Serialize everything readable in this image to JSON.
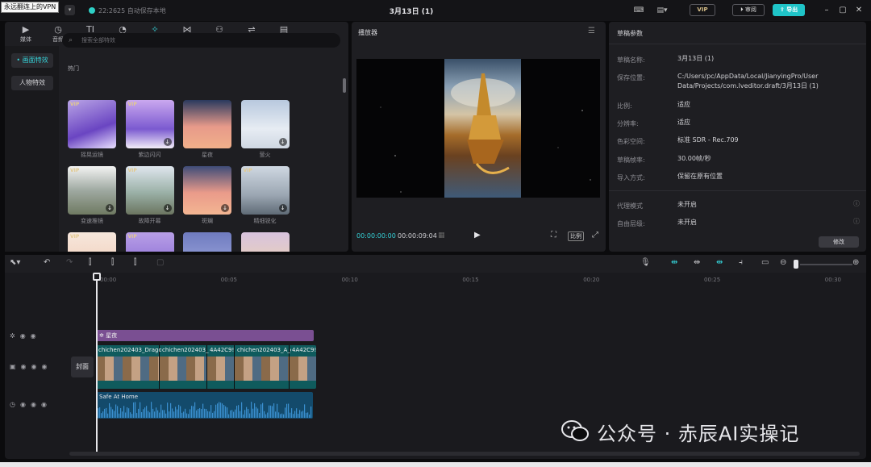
{
  "topbar": {
    "vpn_tip": "永远翻连上的VPN",
    "save_status": "22:2625 自动保存本地",
    "project_title": "3月13日 (1)",
    "vip_label": "VIP",
    "review_label": "审阅",
    "export_label": "导出"
  },
  "library": {
    "tabs": [
      {
        "icon": "▶",
        "label": "媒体"
      },
      {
        "icon": "◷",
        "label": "音频"
      },
      {
        "icon": "TI",
        "label": "文本"
      },
      {
        "icon": "◔",
        "label": "贴纸"
      },
      {
        "icon": "✧",
        "label": "特效"
      },
      {
        "icon": "⋈",
        "label": "转场"
      },
      {
        "icon": "⚇",
        "label": "滤镜"
      },
      {
        "icon": "⇌",
        "label": "调节"
      },
      {
        "icon": "▤",
        "label": "模板"
      }
    ],
    "side": [
      "画面特效",
      "人物特效"
    ],
    "search_placeholder": "搜索全部特效",
    "section": "热门",
    "cards": [
      {
        "label": "摇晃运镜",
        "vip": "VIP"
      },
      {
        "label": "紫边闪闪",
        "vip": "VIP"
      },
      {
        "label": "星夜",
        "vip": ""
      },
      {
        "label": "萤火",
        "vip": ""
      },
      {
        "label": "变速推镜",
        "vip": "VIP"
      },
      {
        "label": "故障开幕",
        "vip": "VIP"
      },
      {
        "label": "斑斓",
        "vip": ""
      },
      {
        "label": "精细锐化",
        "vip": "VIP"
      },
      {
        "label": "",
        "vip": "VIP"
      },
      {
        "label": "",
        "vip": "VIP"
      },
      {
        "label": "",
        "vip": ""
      },
      {
        "label": "",
        "vip": ""
      }
    ]
  },
  "player": {
    "title": "播放器",
    "time_current": "00:00:00:00",
    "time_total": "00:00:09:04",
    "ratio_label": "比例"
  },
  "params": {
    "title": "草稿参数",
    "rows": [
      {
        "k": "草稿名称:",
        "v": "3月13日 (1)"
      },
      {
        "k": "保存位置:",
        "v": "C:/Users/pc/AppData/Local/JianyingPro/User Data/Projects/com.lveditor.draft/3月13日 (1)"
      },
      {
        "k": "比例:",
        "v": "适应"
      },
      {
        "k": "分辨率:",
        "v": "适应"
      },
      {
        "k": "色彩空间:",
        "v": "标准 SDR - Rec.709"
      },
      {
        "k": "草稿帧率:",
        "v": "30.00帧/秒"
      },
      {
        "k": "导入方式:",
        "v": "保留在原有位置"
      },
      {
        "k": "代理模式",
        "v": "未开启"
      },
      {
        "k": "自由层级:",
        "v": "未开启"
      }
    ],
    "modify_label": "修改"
  },
  "timeline": {
    "ticks": [
      "00:00",
      "00:05",
      "00:10",
      "00:15",
      "00:20",
      "00:25",
      "00:30"
    ],
    "cover_label": "封面",
    "effect_clip": "星夜",
    "video_clips": [
      "chichen202403_Drago",
      "chichen202403_",
      "4A42C9!",
      "chichen202403_A_c",
      "4A42C9!"
    ],
    "audio_clip": "Safe At Home"
  },
  "watermark": "公众号 · 赤辰AI实操记"
}
